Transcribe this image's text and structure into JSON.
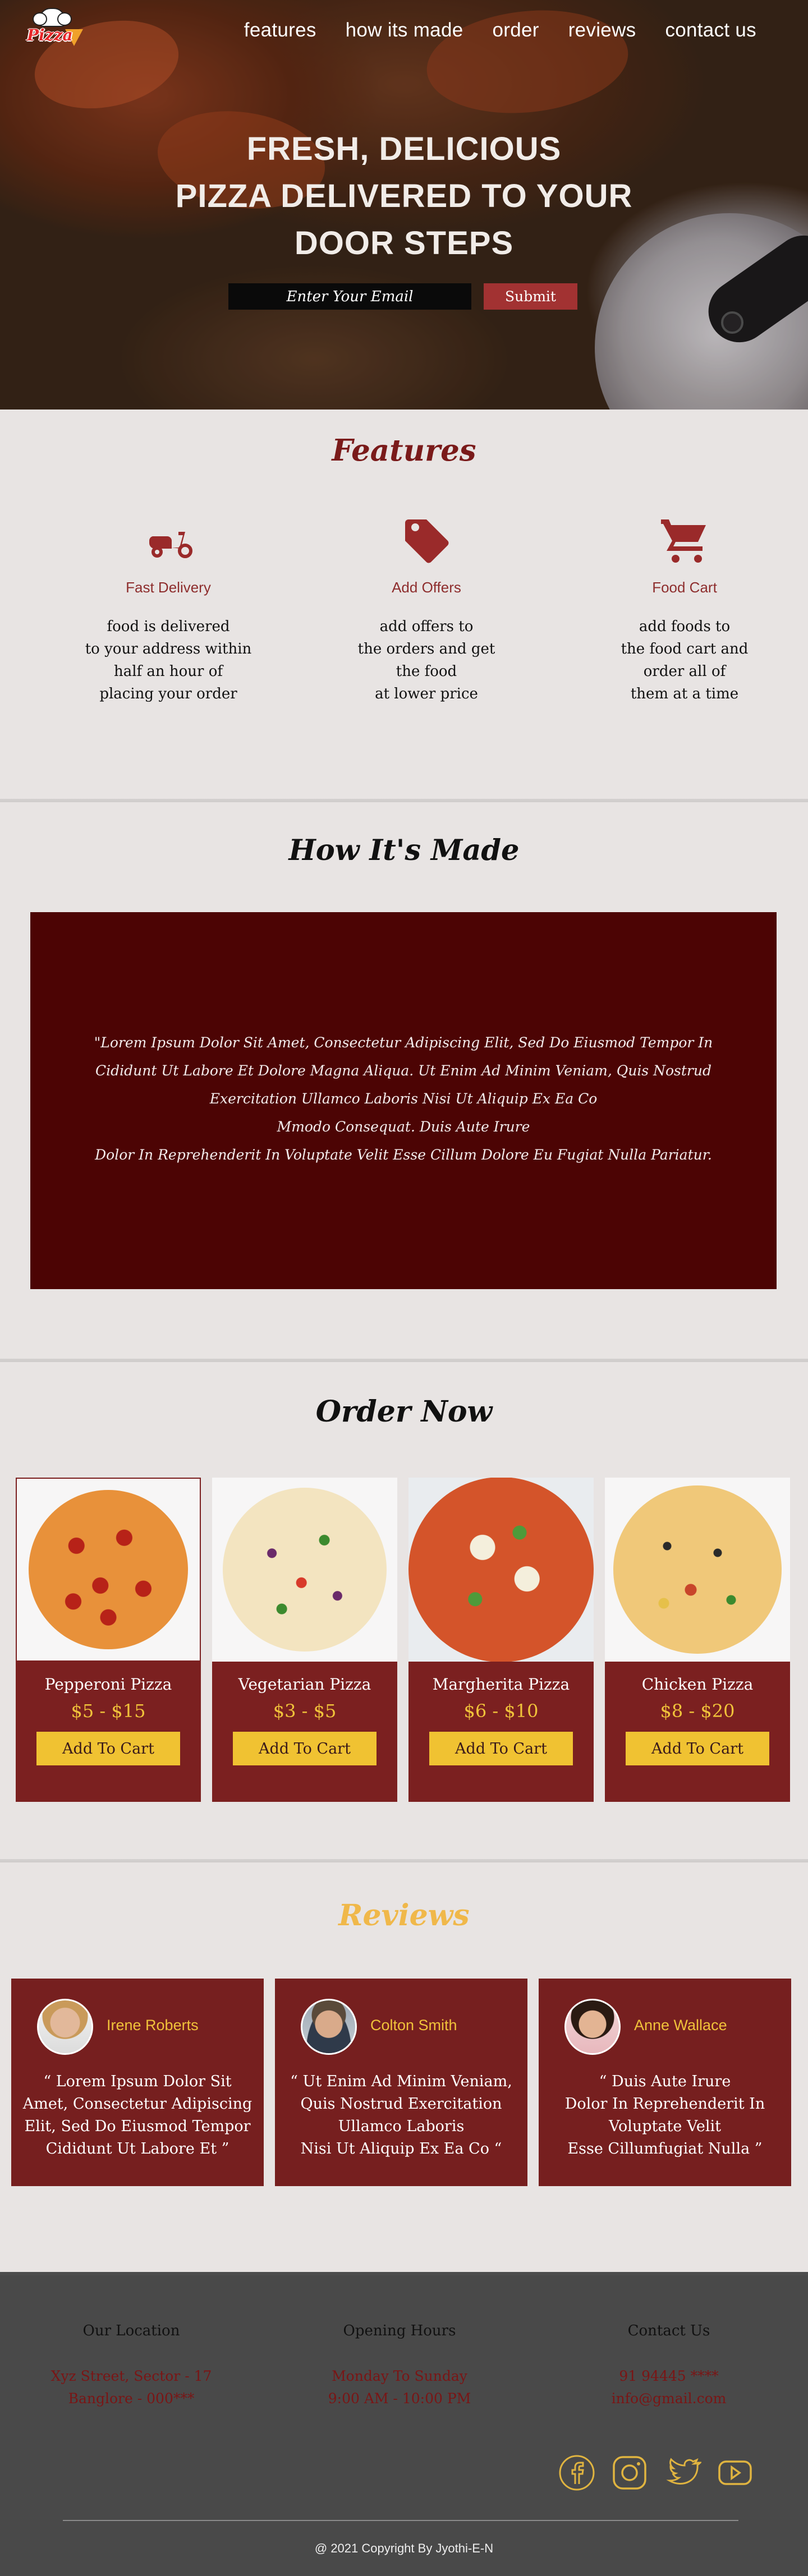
{
  "brand": {
    "logo_text": "Pizza"
  },
  "nav": {
    "links": [
      "features",
      "how its made",
      "order",
      "reviews",
      "contact us"
    ]
  },
  "hero": {
    "title_lines": [
      "FRESH, DELICIOUS",
      "PIZZA DELIVERED TO YOUR",
      "DOOR STEPS"
    ],
    "email_placeholder": "Enter Your Email",
    "submit_label": "Submit"
  },
  "features": {
    "title": "Features",
    "items": [
      {
        "icon": "scooter-icon",
        "label": "Fast Delivery",
        "desc": "food is delivered\nto your address within\nhalf an hour of\nplacing your order"
      },
      {
        "icon": "tag-icon",
        "label": "Add Offers",
        "desc": "add offers to\nthe orders and get\nthe food\nat lower price"
      },
      {
        "icon": "cart-icon",
        "label": "Food Cart",
        "desc": "add foods to\nthe food cart and\norder all of\nthem at a time"
      }
    ]
  },
  "how_made": {
    "title": "How It's Made",
    "text": "\"Lorem Ipsum Dolor Sit Amet, Consectetur Adipiscing Elit, Sed Do Eiusmod Tempor In\nCididunt Ut Labore Et Dolore Magna Aliqua. Ut Enim Ad Minim Veniam, Quis Nostrud\nExercitation Ullamco Laboris Nisi Ut Aliquip Ex Ea Co\nMmodo Consequat. Duis Aute Irure\nDolor In Reprehenderit In Voluptate Velit Esse Cillum Dolore Eu Fugiat Nulla Pariatur."
  },
  "order": {
    "title": "Order Now",
    "cart_label": "Add To Cart",
    "items": [
      {
        "name": "Pepperoni Pizza",
        "price": "$5 - $15"
      },
      {
        "name": "Vegetarian Pizza",
        "price": "$3 - $5"
      },
      {
        "name": "Margherita Pizza",
        "price": "$6 - $10"
      },
      {
        "name": "Chicken Pizza",
        "price": "$8 - $20"
      }
    ]
  },
  "reviews": {
    "title": "Reviews",
    "items": [
      {
        "name": "Irene Roberts",
        "text": "“ Lorem Ipsum Dolor Sit\nAmet, Consectetur Adipiscing\nElit, Sed Do Eiusmod Tempor\nCididunt Ut Labore Et ”"
      },
      {
        "name": "Colton Smith",
        "text": "“ Ut Enim Ad Minim Veniam,\nQuis Nostrud Exercitation\nUllamco Laboris\nNisi Ut Aliquip Ex Ea Co “"
      },
      {
        "name": "Anne Wallace",
        "text": "“ Duis Aute Irure\nDolor In Reprehenderit In\nVoluptate Velit\nEsse Cillumfugiat Nulla ”"
      }
    ]
  },
  "footer": {
    "location": {
      "title": "Our Location",
      "lines": [
        "Xyz Street, Sector - 17",
        "Banglore - 000***"
      ]
    },
    "hours": {
      "title": "Opening Hours",
      "lines": [
        "Monday To Sunday",
        "9:00 AM - 10:00 PM"
      ]
    },
    "contact": {
      "title": "Contact Us",
      "lines": [
        "91 94445 ****",
        "info@gmail.com"
      ]
    },
    "socials": [
      "facebook-icon",
      "instagram-icon",
      "twitter-icon",
      "youtube-icon"
    ],
    "copyright": "@ 2021 Copyright By Jyothi-E-N"
  },
  "colors": {
    "maroon": "#7b2020",
    "dark_maroon": "#4c0404",
    "gold": "#f0c232",
    "submit": "#a23232",
    "page_bg": "#e8e4e3",
    "footer_bg": "#494949"
  }
}
